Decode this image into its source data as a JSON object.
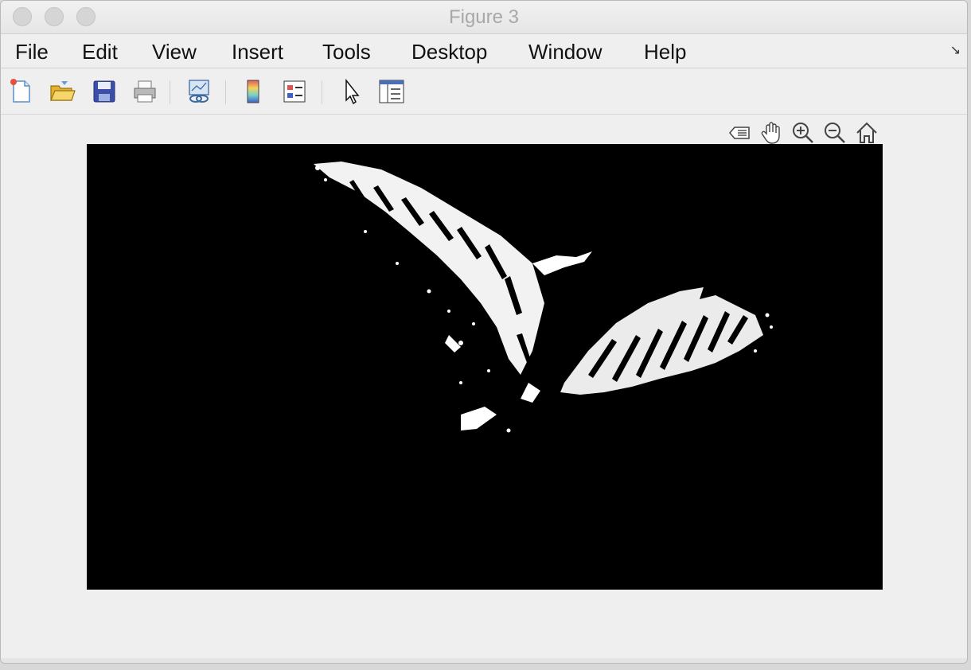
{
  "window": {
    "title": "Figure 3"
  },
  "menu": {
    "items": [
      {
        "label": "File"
      },
      {
        "label": "Edit"
      },
      {
        "label": "View"
      },
      {
        "label": "Insert"
      },
      {
        "label": "Tools"
      },
      {
        "label": "Desktop"
      },
      {
        "label": "Window"
      },
      {
        "label": "Help"
      }
    ]
  },
  "toolbar": {
    "buttons": [
      {
        "icon": "new-figure-icon"
      },
      {
        "icon": "open-file-icon"
      },
      {
        "icon": "save-icon"
      },
      {
        "icon": "print-icon"
      },
      {
        "icon": "link-plot-icon"
      },
      {
        "icon": "insert-colorbar-icon"
      },
      {
        "icon": "insert-legend-icon"
      },
      {
        "icon": "edit-plot-icon"
      },
      {
        "icon": "property-inspector-icon"
      }
    ]
  },
  "axes_toolbar": {
    "buttons": [
      {
        "icon": "data-tips-icon"
      },
      {
        "icon": "pan-icon"
      },
      {
        "icon": "zoom-in-icon"
      },
      {
        "icon": "zoom-out-icon"
      },
      {
        "icon": "restore-view-icon"
      }
    ]
  },
  "figure": {
    "content": "binary image of a butterfly (white on black)",
    "background": "#000000",
    "foreground": "#ffffff"
  }
}
